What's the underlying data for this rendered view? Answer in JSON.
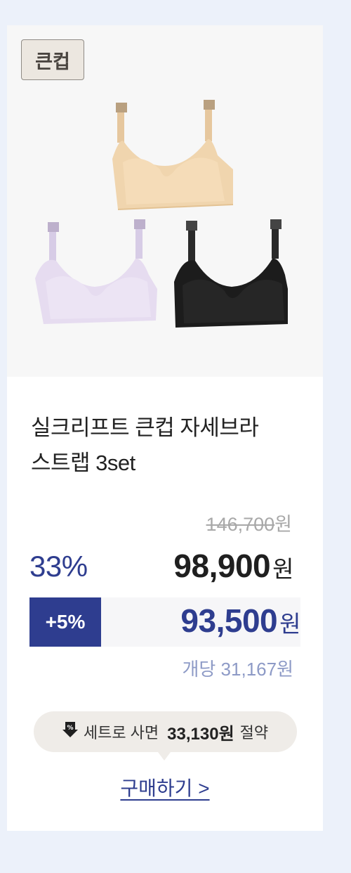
{
  "product": {
    "badge": "큰컵",
    "title_line1": "실크리프트 큰컵 자세브라",
    "title_line2": "스트랩 3set",
    "colors": {
      "beige": "#f0d5ae",
      "lavender": "#e6dcf0",
      "black": "#1c1c1c",
      "accent": "#2e3d8f",
      "background": "#ecf1fa"
    }
  },
  "pricing": {
    "original_price": "146,700",
    "original_unit": "원",
    "discount_rate": "33%",
    "sale_price": "98,900",
    "sale_unit": "원",
    "extra_discount": "+5%",
    "extra_price": "93,500",
    "extra_unit": "원",
    "per_item": "개당 31,167원"
  },
  "tooltip": {
    "icon": "download-discount-icon",
    "prefix": "세트로 사면",
    "amount": "33,130원",
    "suffix": "절약"
  },
  "cta": {
    "label": "구매하기 >"
  }
}
